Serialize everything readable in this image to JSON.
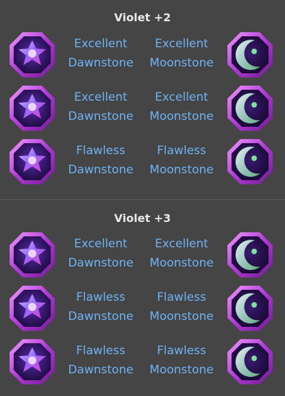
{
  "sections": [
    {
      "title": "Violet +2",
      "rows": [
        {
          "left_quality": "Excellent",
          "left_name": "Dawnstone",
          "right_quality": "Excellent",
          "right_name": "Moonstone"
        },
        {
          "left_quality": "Excellent",
          "left_name": "Dawnstone",
          "right_quality": "Excellent",
          "right_name": "Moonstone"
        },
        {
          "left_quality": "Flawless",
          "left_name": "Dawnstone",
          "right_quality": "Flawless",
          "right_name": "Moonstone"
        }
      ]
    },
    {
      "title": "Violet +3",
      "rows": [
        {
          "left_quality": "Excellent",
          "left_name": "Dawnstone",
          "right_quality": "Excellent",
          "right_name": "Moonstone"
        },
        {
          "left_quality": "Flawless",
          "left_name": "Dawnstone",
          "right_quality": "Flawless",
          "right_name": "Moonstone"
        },
        {
          "left_quality": "Flawless",
          "left_name": "Dawnstone",
          "right_quality": "Flawless",
          "right_name": "Moonstone"
        }
      ]
    }
  ],
  "icons": {
    "left": "dawnstone-icon",
    "right": "moonstone-icon"
  },
  "colors": {
    "background": "#454545",
    "title": "#e8e8e8",
    "label": "#6fb2f5",
    "frame": "#b13ad6"
  }
}
